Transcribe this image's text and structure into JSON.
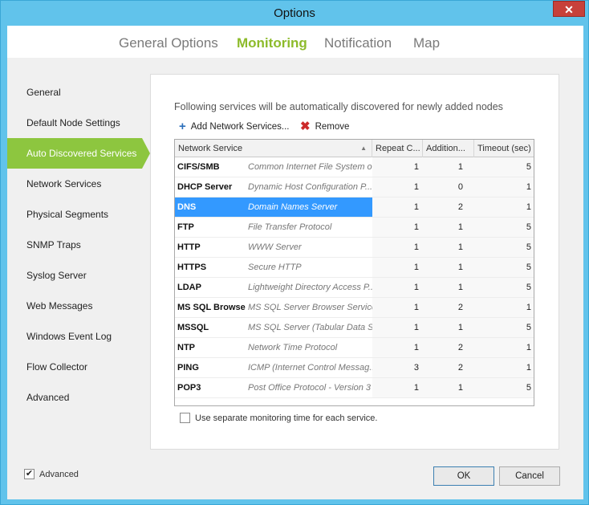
{
  "window": {
    "title": "Options",
    "close_glyph": "✕"
  },
  "tabs": [
    {
      "label": "General Options",
      "active": false
    },
    {
      "label": "Monitoring",
      "active": true
    },
    {
      "label": "Notification",
      "active": false
    },
    {
      "label": "Map",
      "active": false
    }
  ],
  "sidebar": {
    "items": [
      {
        "label": "General",
        "active": false
      },
      {
        "label": "Default Node Settings",
        "active": false
      },
      {
        "label": "Auto Discovered Services",
        "active": true
      },
      {
        "label": "Network Services",
        "active": false
      },
      {
        "label": "Physical Segments",
        "active": false
      },
      {
        "label": "SNMP Traps",
        "active": false
      },
      {
        "label": "Syslog Server",
        "active": false
      },
      {
        "label": "Web Messages",
        "active": false
      },
      {
        "label": "Windows Event Log",
        "active": false
      },
      {
        "label": "Flow Collector",
        "active": false
      },
      {
        "label": "Advanced",
        "active": false
      }
    ]
  },
  "panel": {
    "description": "Following services will  be automatically discovered for newly added nodes",
    "add_label": "Add Network Services...",
    "remove_label": "Remove",
    "add_icon": "plus-icon",
    "remove_icon": "cross-icon"
  },
  "table": {
    "columns": [
      "Network Service",
      "Repeat C...",
      "Addition...",
      "Timeout (sec)"
    ],
    "sort_glyph": "▲",
    "rows": [
      {
        "name": "CIFS/SMB",
        "desc": "Common Internet File System o...",
        "repeat": "1",
        "additional": "1",
        "timeout": "5",
        "selected": false
      },
      {
        "name": "DHCP Server",
        "desc": "Dynamic Host Configuration P...",
        "repeat": "1",
        "additional": "0",
        "timeout": "1",
        "selected": false
      },
      {
        "name": "DNS",
        "desc": "Domain Names Server",
        "repeat": "1",
        "additional": "2",
        "timeout": "1",
        "selected": true
      },
      {
        "name": "FTP",
        "desc": "File Transfer Protocol",
        "repeat": "1",
        "additional": "1",
        "timeout": "5",
        "selected": false
      },
      {
        "name": "HTTP",
        "desc": "WWW Server",
        "repeat": "1",
        "additional": "1",
        "timeout": "5",
        "selected": false
      },
      {
        "name": "HTTPS",
        "desc": "Secure HTTP",
        "repeat": "1",
        "additional": "1",
        "timeout": "5",
        "selected": false
      },
      {
        "name": "LDAP",
        "desc": "Lightweight Directory Access P...",
        "repeat": "1",
        "additional": "1",
        "timeout": "5",
        "selected": false
      },
      {
        "name": "MS SQL Browser",
        "desc": "MS SQL Server Browser Service",
        "repeat": "1",
        "additional": "2",
        "timeout": "1",
        "selected": false
      },
      {
        "name": "MSSQL",
        "desc": "MS SQL Server (Tabular Data St...",
        "repeat": "1",
        "additional": "1",
        "timeout": "5",
        "selected": false
      },
      {
        "name": "NTP",
        "desc": "Network Time Protocol",
        "repeat": "1",
        "additional": "2",
        "timeout": "1",
        "selected": false
      },
      {
        "name": "PING",
        "desc": "ICMP (Internet Control Messag...",
        "repeat": "3",
        "additional": "2",
        "timeout": "1",
        "selected": false
      },
      {
        "name": "POP3",
        "desc": "Post Office Protocol - Version 3",
        "repeat": "1",
        "additional": "1",
        "timeout": "5",
        "selected": false
      }
    ]
  },
  "separate_time": {
    "label": "Use separate monitoring time for each service.",
    "checked": false
  },
  "advanced": {
    "label": "Advanced",
    "checked": true,
    "check_glyph": "✔"
  },
  "buttons": {
    "ok": "OK",
    "cancel": "Cancel"
  }
}
